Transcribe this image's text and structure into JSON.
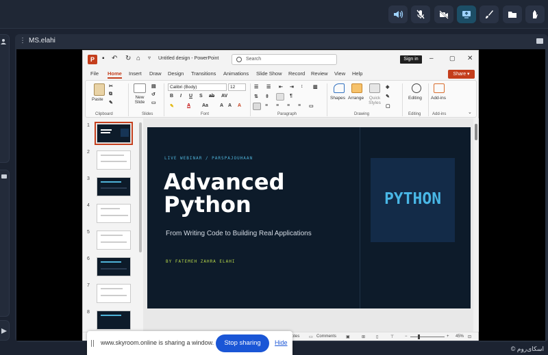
{
  "toolbar": {
    "buttons": [
      {
        "name": "speaker-icon",
        "active": false
      },
      {
        "name": "mic-off-icon",
        "active": false
      },
      {
        "name": "camera-off-icon",
        "active": false
      },
      {
        "name": "screen-share-icon",
        "active": true
      },
      {
        "name": "brush-icon",
        "active": false
      },
      {
        "name": "folder-icon",
        "active": false
      },
      {
        "name": "raise-hand-icon",
        "active": false
      }
    ]
  },
  "stage": {
    "presenter_name": "MS.elahi"
  },
  "powerpoint": {
    "doc_title": "Untitled design  -  PowerPoint",
    "search_placeholder": "Search",
    "sign_in": "Sign in",
    "menu": [
      "File",
      "Home",
      "Insert",
      "Draw",
      "Design",
      "Transitions",
      "Animations",
      "Slide Show",
      "Record",
      "Review",
      "View",
      "Help"
    ],
    "active_menu": "Home",
    "share_label": "Share",
    "ribbon": {
      "groups": [
        "Clipboard",
        "Slides",
        "Font",
        "Paragraph",
        "Drawing",
        "Editing",
        "Add-ins"
      ],
      "paste": "Paste",
      "new_slide": "New Slide",
      "font_name": "Calibri (Body)",
      "font_size": "12",
      "shapes": "Shapes",
      "arrange": "Arrange",
      "quick_styles": "Quick Styles",
      "editing": "Editing",
      "add_ins": "Add-ins"
    },
    "thumbnails": [
      "1",
      "2",
      "3",
      "4",
      "5",
      "6",
      "7",
      "8"
    ],
    "slide": {
      "kicker": "LIVE WEBINAR  /  PARSPAJOUHAAN",
      "title": "Advanced Python",
      "subtitle": "From Writing Code to Building Real Applications",
      "author": "BY FATEMEH ZAHRA ELAHI",
      "badge": "PYTHON"
    },
    "status": {
      "notes": "otes",
      "comments": "Comments",
      "zoom": "45%"
    }
  },
  "sharing": {
    "message": "www.skyroom.online is sharing a window.",
    "stop": "Stop sharing",
    "hide": "Hide"
  },
  "brand": "اسکای‌روم ©"
}
